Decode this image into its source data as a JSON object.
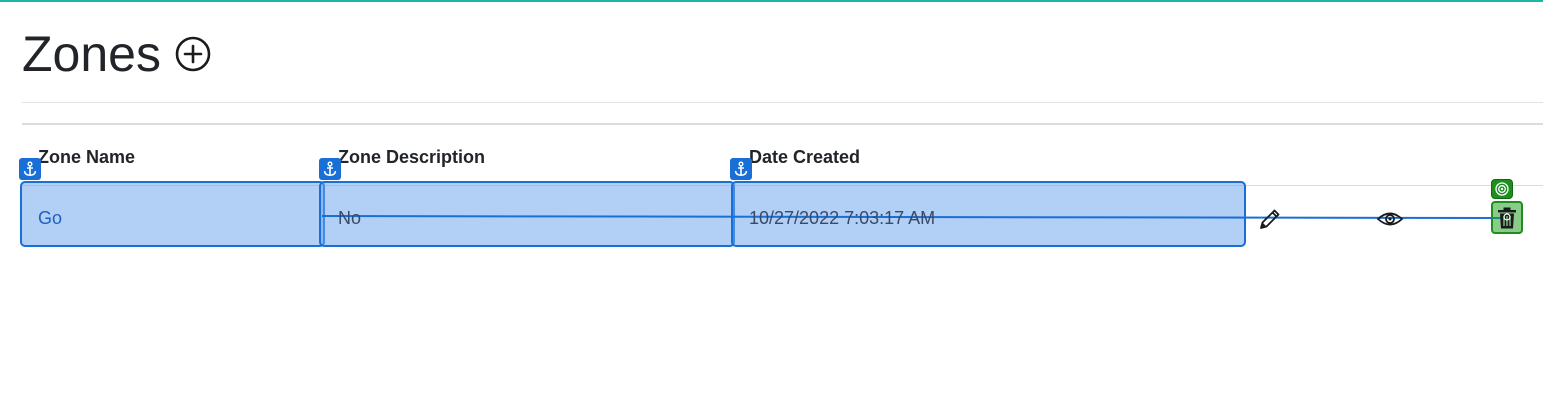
{
  "page": {
    "title": "Zones",
    "accent_color": "#1fb5a6"
  },
  "toolbar": {
    "add_icon": "plus-circle-icon"
  },
  "table": {
    "headers": [
      "Zone Name",
      "Zone Description",
      "Date Created"
    ],
    "rows": [
      {
        "zone_name": "Go",
        "zone_description": "No",
        "date_created": "10/27/2022 7:03:17 AM",
        "actions": [
          "pencil-icon",
          "eye-icon",
          "trash-icon"
        ]
      }
    ]
  },
  "overlay": {
    "highlight_color": "#1a6fd6",
    "selected_action_color": "#1e8f1e",
    "anchor_icon": "anchor-icon",
    "target_icon": "target-icon"
  }
}
